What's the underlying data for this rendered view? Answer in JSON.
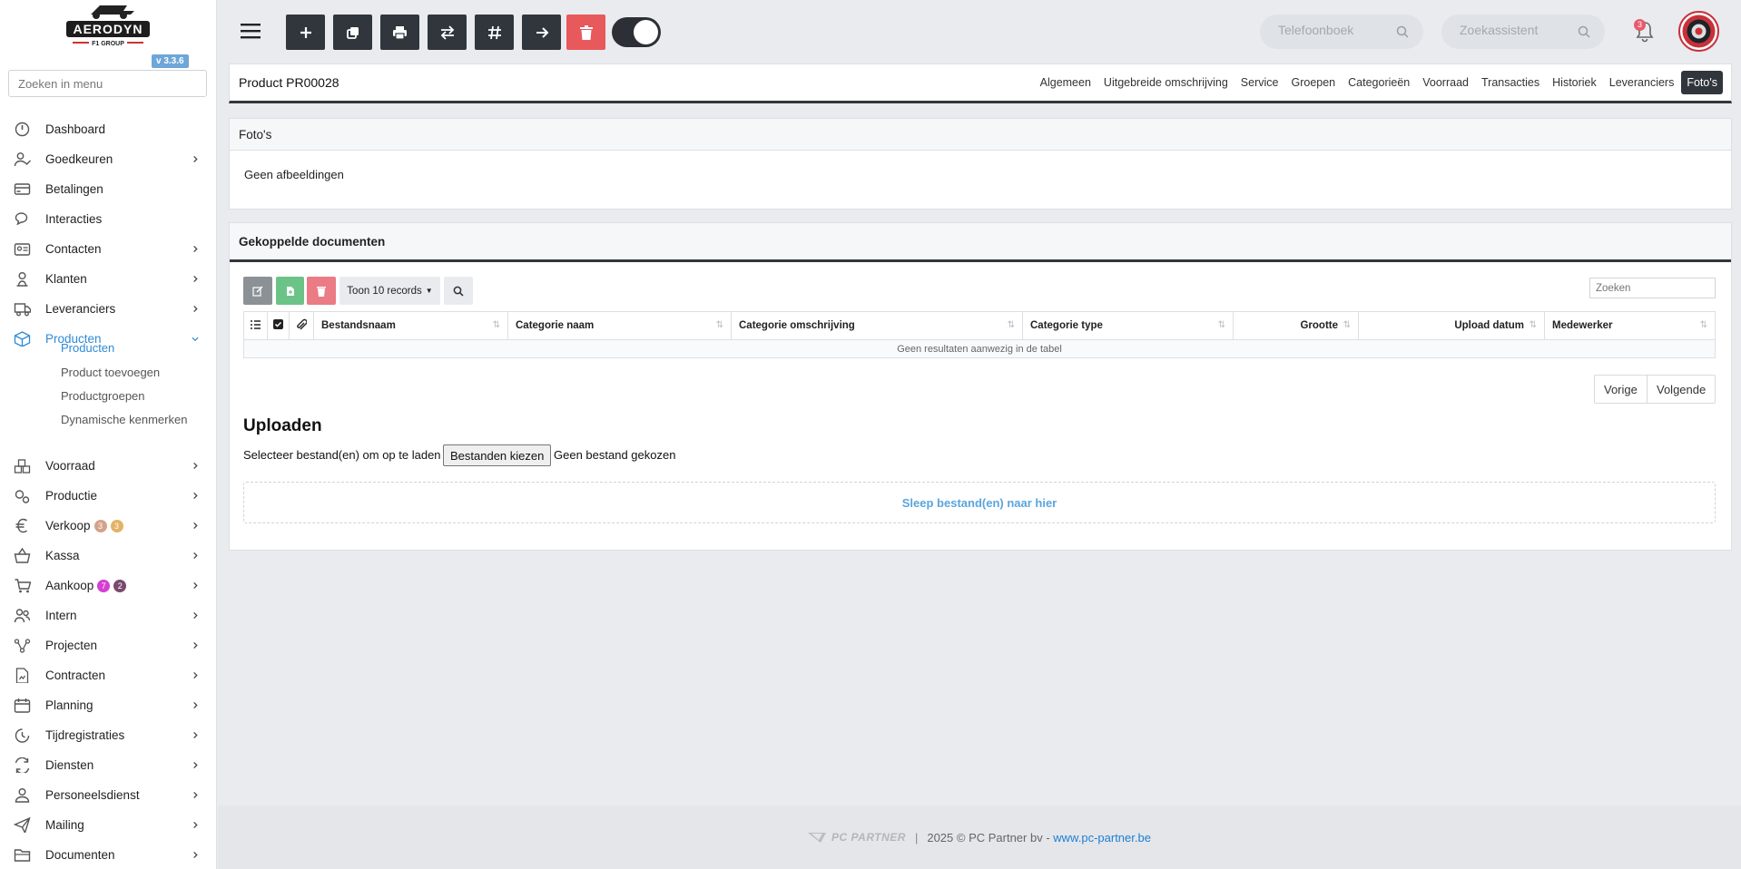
{
  "brand": {
    "logo_text": "AERODYN",
    "logo_sub": "F1 GROUP",
    "version": "v 3.3.6"
  },
  "sidebar": {
    "search_placeholder": "Zoeken in menu",
    "items": [
      {
        "label": "Dashboard",
        "icon": "dashboard-icon",
        "chevron": false
      },
      {
        "label": "Goedkeuren",
        "icon": "user-check-icon",
        "chevron": true
      },
      {
        "label": "Betalingen",
        "icon": "credit-card-icon",
        "chevron": false
      },
      {
        "label": "Interacties",
        "icon": "chat-icon",
        "chevron": false
      },
      {
        "label": "Contacten",
        "icon": "contact-card-icon",
        "chevron": true
      },
      {
        "label": "Klanten",
        "icon": "customer-icon",
        "chevron": true
      },
      {
        "label": "Leveranciers",
        "icon": "truck-icon",
        "chevron": true
      },
      {
        "label": "Producten",
        "icon": "box-icon",
        "chevron": true,
        "active": true
      },
      {
        "label": "Voorraad",
        "icon": "stock-icon",
        "chevron": true
      },
      {
        "label": "Productie",
        "icon": "gears-icon",
        "chevron": true
      },
      {
        "label": "Verkoop",
        "icon": "euro-icon",
        "chevron": true
      },
      {
        "label": "Kassa",
        "icon": "basket-icon",
        "chevron": true
      },
      {
        "label": "Aankoop",
        "icon": "cart-icon",
        "chevron": true
      },
      {
        "label": "Intern",
        "icon": "users-icon",
        "chevron": true
      },
      {
        "label": "Projecten",
        "icon": "project-icon",
        "chevron": true
      },
      {
        "label": "Contracten",
        "icon": "contract-icon",
        "chevron": true
      },
      {
        "label": "Planning",
        "icon": "calendar-icon",
        "chevron": true
      },
      {
        "label": "Tijdregistraties",
        "icon": "clock-icon",
        "chevron": true
      },
      {
        "label": "Diensten",
        "icon": "refresh-icon",
        "chevron": true
      },
      {
        "label": "Personeelsdienst",
        "icon": "staff-icon",
        "chevron": true
      },
      {
        "label": "Mailing",
        "icon": "send-icon",
        "chevron": true
      },
      {
        "label": "Documenten",
        "icon": "folder-icon",
        "chevron": true
      }
    ],
    "sub_items": [
      "Producten",
      "Product toevoegen",
      "Productgroepen",
      "Dynamische kenmerken"
    ],
    "verkoop_badges": [
      "3",
      "3"
    ],
    "aankoop_badges": [
      "7",
      "2"
    ]
  },
  "topbar": {
    "phonebook_placeholder": "Telefoonboek",
    "assistant_placeholder": "Zoekassistent",
    "notification_count": "3"
  },
  "product": {
    "title": "Product PR00028",
    "tabs": [
      "Algemeen",
      "Uitgebreide omschrijving",
      "Service",
      "Groepen",
      "Categorieën",
      "Voorraad",
      "Transacties",
      "Historiek",
      "Leveranciers",
      "Foto's"
    ]
  },
  "photos": {
    "title": "Foto's",
    "empty_text": "Geen afbeeldingen"
  },
  "documents": {
    "title": "Gekoppelde documenten",
    "records_label": "Toon 10 records",
    "search_placeholder": "Zoeken",
    "columns": [
      "Bestandsnaam",
      "Categorie naam",
      "Categorie omschrijving",
      "Categorie type",
      "Grootte",
      "Upload datum",
      "Medewerker"
    ],
    "empty_row": "Geen resultaten aanwezig in de tabel",
    "prev": "Vorige",
    "next": "Volgende"
  },
  "upload": {
    "title": "Uploaden",
    "select_label": "Selecteer bestand(en) om op te laden",
    "choose_button": "Bestanden kiezen",
    "no_file": "Geen bestand gekozen",
    "dropzone": "Sleep bestand(en) naar hier"
  },
  "footer": {
    "brand": "PC PARTNER",
    "copyright": "2025 © PC Partner bv - ",
    "link": "www.pc-partner.be"
  },
  "colors": {
    "accent": "#2d8ad6",
    "dark": "#31363d",
    "danger": "#e8595c",
    "success": "#6cc387"
  }
}
